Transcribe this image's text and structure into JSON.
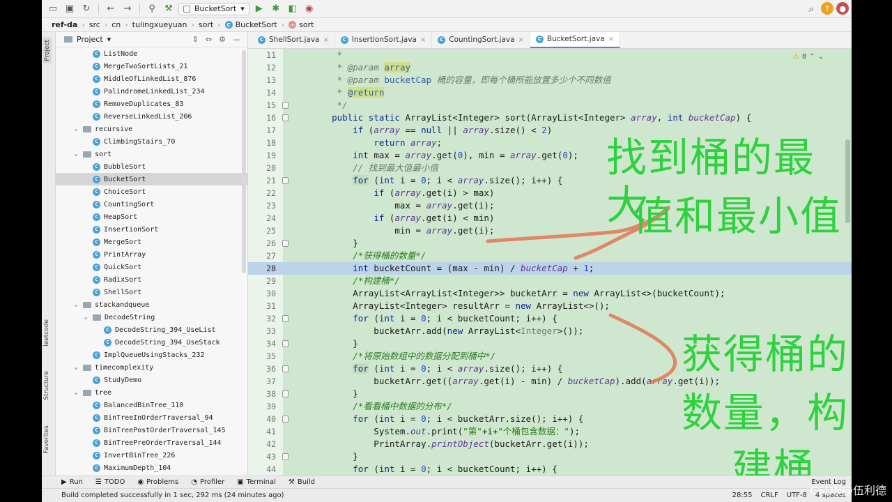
{
  "toolbar": {
    "run_config": "BucketSort",
    "icons": [
      "save-all-icon",
      "open-icon",
      "sync-icon",
      "back-icon",
      "forward-icon",
      "vcs-icon",
      "build-icon",
      "run-icon",
      "debug-icon",
      "coverage-icon",
      "profile-icon",
      "search-icon",
      "update-icon",
      "avatar-icon"
    ]
  },
  "breadcrumb": [
    "ref-da",
    "src",
    "cn",
    "tulingxueyuan",
    "sort",
    "BucketSort",
    "sort"
  ],
  "project_panel": {
    "title": "Project",
    "items": [
      {
        "label": "ListNode",
        "type": "class",
        "indent": 3
      },
      {
        "label": "MergeTwoSortLists_21",
        "type": "class",
        "indent": 3
      },
      {
        "label": "MiddleOfLinkedList_876",
        "type": "class",
        "indent": 3
      },
      {
        "label": "PalindromeLinkedList_234",
        "type": "class",
        "indent": 3
      },
      {
        "label": "RemoveDuplicates_83",
        "type": "class",
        "indent": 3
      },
      {
        "label": "ReverseLinkedList_206",
        "type": "class",
        "indent": 3
      },
      {
        "label": "recursive",
        "type": "folder",
        "indent": 2
      },
      {
        "label": "ClimbingStairs_70",
        "type": "class",
        "indent": 3
      },
      {
        "label": "sort",
        "type": "folder",
        "indent": 2
      },
      {
        "label": "BubbleSort",
        "type": "class",
        "indent": 3
      },
      {
        "label": "BucketSort",
        "type": "class",
        "indent": 3,
        "selected": true
      },
      {
        "label": "ChoiceSort",
        "type": "class",
        "indent": 3
      },
      {
        "label": "CountingSort",
        "type": "class",
        "indent": 3
      },
      {
        "label": "HeapSort",
        "type": "class",
        "indent": 3
      },
      {
        "label": "InsertionSort",
        "type": "class",
        "indent": 3
      },
      {
        "label": "MergeSort",
        "type": "class",
        "indent": 3
      },
      {
        "label": "PrintArray",
        "type": "class",
        "indent": 3
      },
      {
        "label": "QuickSort",
        "type": "class",
        "indent": 3
      },
      {
        "label": "RadixSort",
        "type": "class",
        "indent": 3
      },
      {
        "label": "ShellSort",
        "type": "class",
        "indent": 3
      },
      {
        "label": "stackandqueue",
        "type": "folder",
        "indent": 2
      },
      {
        "label": "DecodeString",
        "type": "folder",
        "indent": 3
      },
      {
        "label": "DecodeString_394_UseList",
        "type": "class",
        "indent": 4
      },
      {
        "label": "DecodeString_394_UseStack",
        "type": "class",
        "indent": 4
      },
      {
        "label": "ImplQueueUsingStacks_232",
        "type": "class",
        "indent": 3
      },
      {
        "label": "timecomplexity",
        "type": "folder",
        "indent": 2
      },
      {
        "label": "StudyDemo",
        "type": "class",
        "indent": 3
      },
      {
        "label": "tree",
        "type": "folder",
        "indent": 2
      },
      {
        "label": "BalancedBinTree_110",
        "type": "class",
        "indent": 3
      },
      {
        "label": "BinTreeInOrderTraversal_94",
        "type": "class",
        "indent": 3
      },
      {
        "label": "BinTreePostOrderTraversal_145",
        "type": "class",
        "indent": 3
      },
      {
        "label": "BinTreePreOrderTraversal_144",
        "type": "class",
        "indent": 3
      },
      {
        "label": "InvertBinTree_226",
        "type": "class",
        "indent": 3
      },
      {
        "label": "MaximumDepth_104",
        "type": "class",
        "indent": 3
      }
    ]
  },
  "left_strip": {
    "project": "Project",
    "leetcode": "leetcode",
    "structure": "Structure",
    "favorites": "Favorites"
  },
  "tabs": [
    {
      "label": "ShellSort.java",
      "active": false
    },
    {
      "label": "InsertionSort.java",
      "active": false
    },
    {
      "label": "CountingSort.java",
      "active": false
    },
    {
      "label": "BucketSort.java",
      "active": true
    }
  ],
  "warnings": "8",
  "code_lines": [
    {
      "n": "11",
      "html": "     <span class='cm'>*</span>"
    },
    {
      "n": "12",
      "html": "     <span class='cm'>* @param </span><span class='param-bg'>array</span>"
    },
    {
      "n": "13",
      "html": "     <span class='cm'>* @param </span><span class='cmtag'>bucketCap</span><span class='cm'> 桶的容量，即每个桶所能放置多少个不同数值</span>"
    },
    {
      "n": "14",
      "html": "     <span class='cm'>* </span><span class='cmtag-bg'>@return</span>"
    },
    {
      "n": "15",
      "html": "     <span class='cm'>*/</span>"
    },
    {
      "n": "16",
      "html": "    <span class='kw'>public static</span> ArrayList&lt;Integer&gt; sort(ArrayList&lt;Integer&gt; <span class='it'>array</span>, <span class='kw'>int</span> <span class='it'>bucketCap</span>) {"
    },
    {
      "n": "17",
      "html": "        <span class='kw'>if</span> (<span class='it'>array</span> == <span class='kw'>null</span> || <span class='it'>array</span>.size() &lt; <span class='num'>2</span>)"
    },
    {
      "n": "18",
      "html": "            <span class='kw'>return</span> <span class='it'>array</span>;"
    },
    {
      "n": "19",
      "html": "        <span class='kw'>int</span> max = <span class='it'>array</span>.get(<span class='num'>0</span>), min = <span class='it'>array</span>.get(<span class='num'>0</span>);"
    },
    {
      "n": "20",
      "html": "        <span class='cm'>// 找到最大值最小值</span>"
    },
    {
      "n": "21",
      "html": "        <span class='kw hl'>for</span> (<span class='kw'>int</span> i = <span class='num'>0</span>; i &lt; <span class='it'>array</span>.size(); i++) {"
    },
    {
      "n": "22",
      "html": "            <span class='kw'>if</span> (<span class='it'>array</span>.get(i) &gt; max)"
    },
    {
      "n": "23",
      "html": "                max = <span class='it'>array</span>.get(i);"
    },
    {
      "n": "24",
      "html": "            <span class='kw'>if</span> (<span class='it'>array</span>.get(i) &lt; min)"
    },
    {
      "n": "25",
      "html": "                min = <span class='it'>array</span>.get(i);"
    },
    {
      "n": "26",
      "html": "        }"
    },
    {
      "n": "27",
      "html": "        <span class='cmt-green'>/*获得桶的数量*/</span>"
    },
    {
      "n": "28",
      "html": "        <span class='kw'>int</span> bucketCount = (max - min) / <span class='it'>bucketCap</span> + <span class='num'>1</span>;",
      "current": true
    },
    {
      "n": "29",
      "html": "        <span class='cmt-green'>/*构建桶*/</span>"
    },
    {
      "n": "30",
      "html": "        ArrayList&lt;ArrayList&lt;Integer&gt;&gt; bucketArr = <span class='kw'>new</span> ArrayList&lt;&gt;(bucketCount);"
    },
    {
      "n": "31",
      "html": "        ArrayList&lt;Integer&gt; resultArr = <span class='kw'>new</span> ArrayList&lt;&gt;();"
    },
    {
      "n": "32",
      "html": "        <span class='kw'>for</span> (<span class='kw'>int</span> i = <span class='num'>0</span>; i &lt; bucketCount; i++) {"
    },
    {
      "n": "33",
      "html": "            bucketArr.add(<span class='kw'>new</span> ArrayList&lt;<span class='gray'>Integer</span>&gt;());"
    },
    {
      "n": "34",
      "html": "        }"
    },
    {
      "n": "35",
      "html": "        <span class='cmt-green'>/*将原始数组中的数据分配到桶中*/</span>"
    },
    {
      "n": "36",
      "html": "        <span class='kw hl'>for</span> (<span class='kw'>int</span> i = <span class='num'>0</span>; i &lt; <span class='it'>array</span>.size(); i++) {"
    },
    {
      "n": "37",
      "html": "            bucketArr.get((<span class='it'>array</span>.get(i) - min) / <span class='it'>bucketCap</span>).add(<span class='it'>array</span>.get(i));"
    },
    {
      "n": "38",
      "html": "        }"
    },
    {
      "n": "39",
      "html": "        <span class='cmt-green'>/*看看桶中数据的分布*/</span>"
    },
    {
      "n": "40",
      "html": "        <span class='kw'>for</span> (<span class='kw'>int</span> i = <span class='num'>0</span>; i &lt; bucketArr.size(); i++) {"
    },
    {
      "n": "41",
      "html": "            System.<span class='it'>out</span>.print(<span class='str'>\"第\"</span>+i+<span class='str'>\"个桶包含数据：\"</span>);"
    },
    {
      "n": "42",
      "html": "            PrintArray.<span class='it'>printObject</span>(bucketArr.get(i));"
    },
    {
      "n": "43",
      "html": "        }"
    },
    {
      "n": "44",
      "html": "        <span class='kw'>for</span> (<span class='kw'>int</span> i = <span class='num'>0</span>; i &lt; bucketCount; i++) {"
    }
  ],
  "annotations": {
    "top_line1": "找到桶的最大",
    "top_line2": "值和最小值",
    "bottom_line1": "获得桶的",
    "bottom_line2": "数量，构",
    "bottom_line3": "建桶"
  },
  "tool_windows": [
    "Run",
    "TODO",
    "Problems",
    "Profiler",
    "Terminal",
    "Build"
  ],
  "event_log": "Event Log",
  "status": {
    "message": "Build completed successfully in 1 sec, 292 ms (24 minutes ago)",
    "position": "28:55",
    "line_sep": "CRLF",
    "encoding": "UTF-8",
    "indent": "4 spaces"
  },
  "watermark": "CSDN@伍利德",
  "colors": {
    "editor_bg": "#cfe7cf",
    "annotation": "#2fd13f",
    "scribble": "#e07850",
    "current_line": "#bcd3ea"
  }
}
